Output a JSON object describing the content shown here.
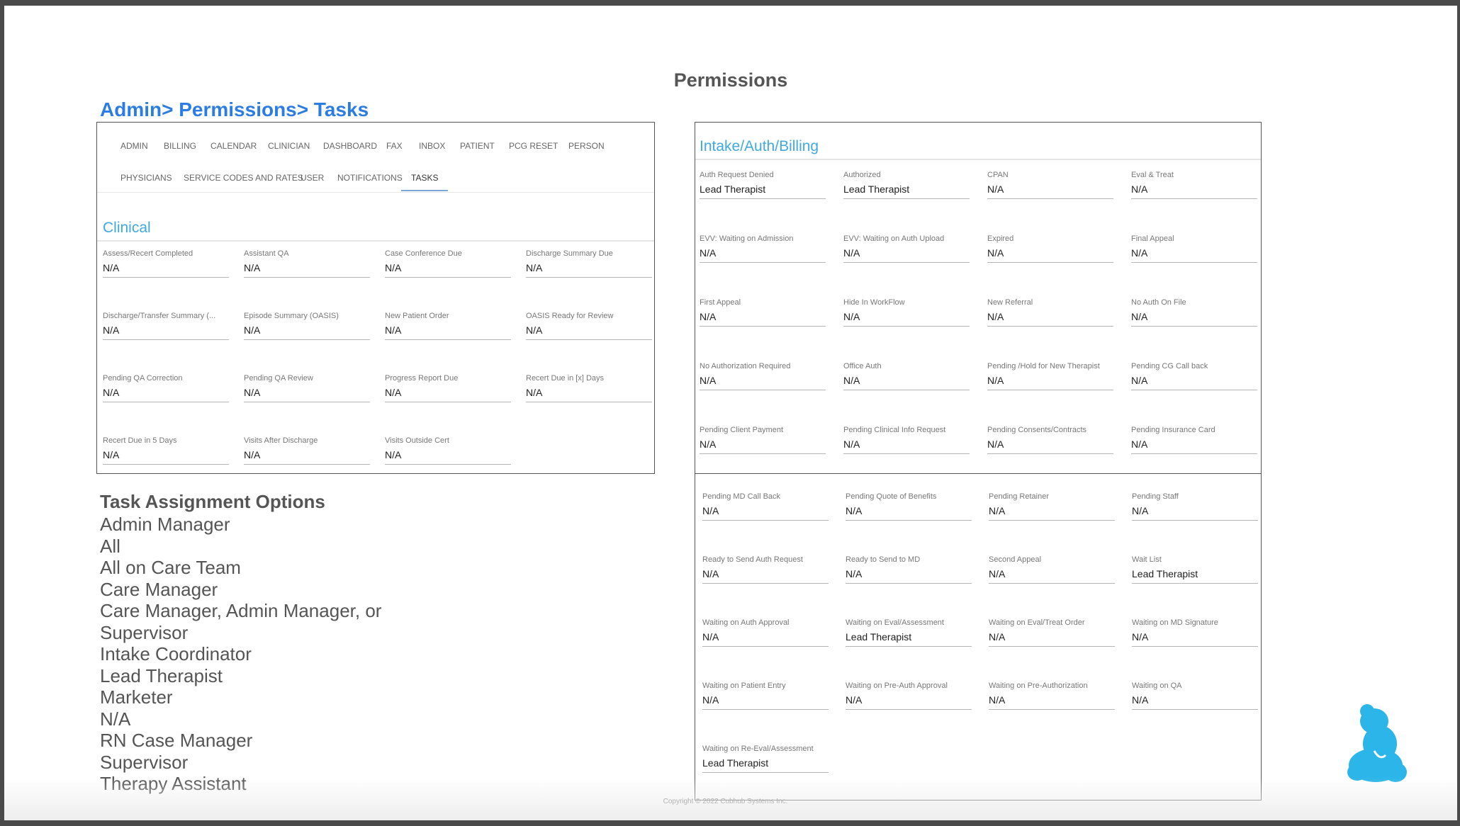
{
  "page_title": "Permissions",
  "breadcrumb": "Admin> Permissions> Tasks",
  "tabs_row1": [
    "ADMIN",
    "BILLING",
    "CALENDAR",
    "CLINICIAN",
    "DASHBOARD",
    "FAX",
    "INBOX",
    "PATIENT",
    "PCG RESET",
    "PERSON"
  ],
  "tabs_row2": [
    "PHYSICIANS",
    "SERVICE CODES AND RATES",
    "USER",
    "NOTIFICATIONS",
    "TASKS"
  ],
  "active_tab": "TASKS",
  "clinical": {
    "title": "Clinical",
    "fields": [
      {
        "label": "Assess/Recert Completed",
        "value": "N/A"
      },
      {
        "label": "Assistant QA",
        "value": "N/A"
      },
      {
        "label": "Case Conference Due",
        "value": "N/A"
      },
      {
        "label": "Discharge Summary Due",
        "value": "N/A"
      },
      {
        "label": "Discharge/Transfer Summary (...",
        "value": "N/A"
      },
      {
        "label": "Episode Summary (OASIS)",
        "value": "N/A"
      },
      {
        "label": "New Patient Order",
        "value": "N/A"
      },
      {
        "label": "OASIS Ready for Review",
        "value": "N/A"
      },
      {
        "label": "Pending QA Correction",
        "value": "N/A"
      },
      {
        "label": "Pending QA Review",
        "value": "N/A"
      },
      {
        "label": "Progress Report Due",
        "value": "N/A"
      },
      {
        "label": "Recert Due in [x] Days",
        "value": "N/A"
      },
      {
        "label": "Recert Due in 5 Days",
        "value": "N/A"
      },
      {
        "label": "Visits After Discharge",
        "value": "N/A"
      },
      {
        "label": "Visits Outside Cert",
        "value": "N/A"
      }
    ]
  },
  "intake": {
    "title": "Intake/Auth/Billing",
    "fields_top": [
      {
        "label": "Auth Request Denied",
        "value": "Lead Therapist"
      },
      {
        "label": "Authorized",
        "value": "Lead Therapist"
      },
      {
        "label": "CPAN",
        "value": "N/A"
      },
      {
        "label": "Eval & Treat",
        "value": "N/A"
      },
      {
        "label": "EVV: Waiting on Admission",
        "value": "N/A"
      },
      {
        "label": "EVV: Waiting on Auth Upload",
        "value": "N/A"
      },
      {
        "label": "Expired",
        "value": "N/A"
      },
      {
        "label": "Final Appeal",
        "value": "N/A"
      },
      {
        "label": "First Appeal",
        "value": "N/A"
      },
      {
        "label": "Hide In WorkFlow",
        "value": "N/A"
      },
      {
        "label": "New Referral",
        "value": "N/A"
      },
      {
        "label": "No Auth On File",
        "value": "N/A"
      },
      {
        "label": "No Authorization Required",
        "value": "N/A"
      },
      {
        "label": "Office Auth",
        "value": "N/A"
      },
      {
        "label": "Pending /Hold for New Therapist",
        "value": "N/A"
      },
      {
        "label": "Pending CG Call back",
        "value": "N/A"
      },
      {
        "label": "Pending Client Payment",
        "value": "N/A"
      },
      {
        "label": "Pending Clinical Info Request",
        "value": "N/A"
      },
      {
        "label": "Pending Consents/Contracts",
        "value": "N/A"
      },
      {
        "label": "Pending Insurance Card",
        "value": "N/A"
      }
    ],
    "fields_bottom": [
      {
        "label": "Pending MD Call Back",
        "value": "N/A"
      },
      {
        "label": "Pending Quote of Benefits",
        "value": "N/A"
      },
      {
        "label": "Pending Retainer",
        "value": "N/A"
      },
      {
        "label": "Pending Staff",
        "value": "N/A"
      },
      {
        "label": "Ready to Send Auth Request",
        "value": "N/A"
      },
      {
        "label": "Ready to Send to MD",
        "value": "N/A"
      },
      {
        "label": "Second Appeal",
        "value": "N/A"
      },
      {
        "label": "Wait List",
        "value": "Lead Therapist"
      },
      {
        "label": "Waiting on Auth Approval",
        "value": "N/A"
      },
      {
        "label": "Waiting on Eval/Assessment",
        "value": "Lead Therapist"
      },
      {
        "label": "Waiting on Eval/Treat Order",
        "value": "N/A"
      },
      {
        "label": "Waiting on MD Signature",
        "value": "N/A"
      },
      {
        "label": "Waiting on Patient Entry",
        "value": "N/A"
      },
      {
        "label": "Waiting on Pre-Auth Approval",
        "value": "N/A"
      },
      {
        "label": "Waiting on Pre-Authorization",
        "value": "N/A"
      },
      {
        "label": "Waiting on QA",
        "value": "N/A"
      },
      {
        "label": "Waiting on Re-Eval/Assessment",
        "value": "Lead Therapist"
      }
    ]
  },
  "task_options": {
    "title": "Task Assignment Options",
    "items": [
      "Admin Manager",
      "All",
      "All on Care Team",
      "Care Manager",
      "Care Manager, Admin Manager, or Supervisor",
      "Intake Coordinator",
      "Lead Therapist",
      "Marketer",
      "N/A",
      "RN Case Manager",
      "Supervisor",
      "Therapy Assistant"
    ]
  },
  "copyright": "Copyright © 2022 Cubhub Systems Inc.",
  "colors": {
    "accent_blue": "#2b7de3",
    "section_blue": "#41a9df",
    "logo_blue": "#2bb5e8"
  }
}
